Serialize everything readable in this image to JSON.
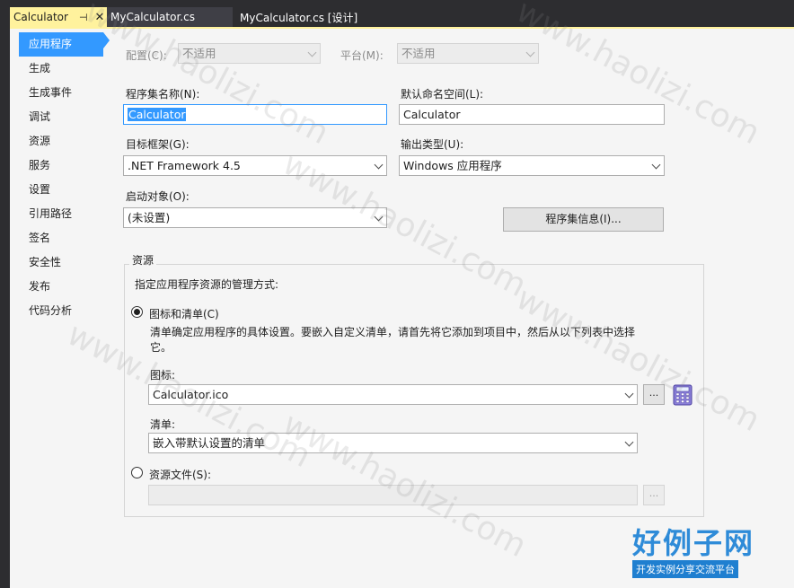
{
  "tabs": [
    {
      "label": "Calculator",
      "pin": "⊣",
      "close": "✕"
    },
    {
      "label": "MyCalculator.cs"
    },
    {
      "label": "MyCalculator.cs [设计]"
    }
  ],
  "nav": [
    "应用程序",
    "生成",
    "生成事件",
    "调试",
    "资源",
    "服务",
    "设置",
    "引用路径",
    "签名",
    "安全性",
    "发布",
    "代码分析"
  ],
  "config": {
    "label": "配置(C):",
    "value": "不适用",
    "platform_label": "平台(M):",
    "platform_value": "不适用"
  },
  "assembly": {
    "label": "程序集名称(N):",
    "value": "Calculator"
  },
  "namespace": {
    "label": "默认命名空间(L):",
    "value": "Calculator"
  },
  "framework": {
    "label": "目标框架(G):",
    "value": ".NET Framework 4.5"
  },
  "output": {
    "label": "输出类型(U):",
    "value": "Windows 应用程序"
  },
  "startup": {
    "label": "启动对象(O):",
    "value": "(未设置)"
  },
  "assembly_info_button": "程序集信息(I)...",
  "resources": {
    "title": "资源",
    "description": "指定应用程序资源的管理方式:",
    "icon_manifest_option": "图标和清单(C)",
    "icon_manifest_help": "清单确定应用程序的具体设置。要嵌入自定义清单，请首先将它添加到项目中，然后从以下列表中选择它。",
    "icon_label": "图标:",
    "icon_value": "Calculator.ico",
    "browse": "...",
    "manifest_label": "清单:",
    "manifest_value": "嵌入带默认设置的清单",
    "resource_file_option": "资源文件(S):",
    "resource_file_value": ""
  },
  "watermark": "www.haolizi.com",
  "brand": {
    "title": "好例子网",
    "subtitle": "开发实例分享交流平台"
  }
}
